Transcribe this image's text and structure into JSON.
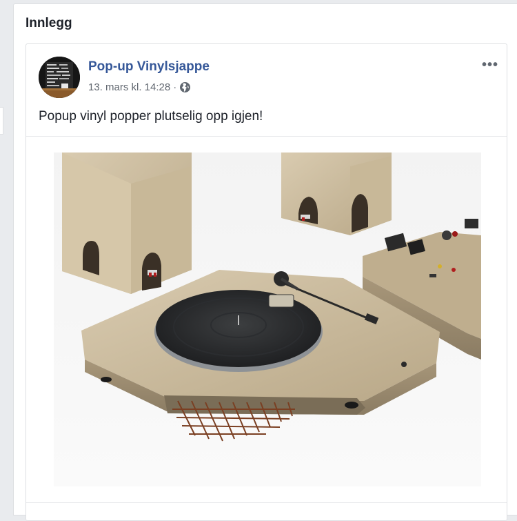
{
  "section": {
    "title": "Innlegg"
  },
  "post": {
    "page_name": "Pop-up Vinylsjappe",
    "timestamp": "13. mars kl. 14:28",
    "separator": "·",
    "audience_icon": "globe-icon",
    "options_icon": "more-options-icon",
    "options_label": "•••",
    "text": "Popup vinyl popper plutselig opp igjen!",
    "photo_description_icon": "turntable-photo"
  }
}
